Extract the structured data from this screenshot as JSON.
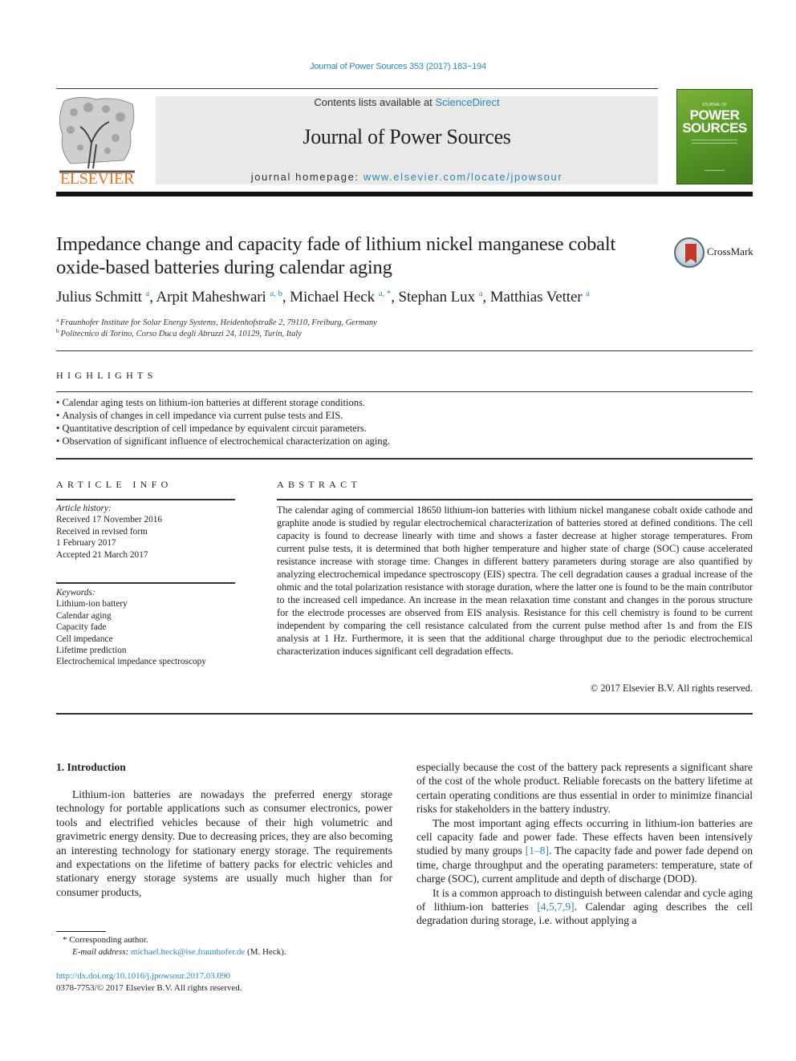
{
  "journal_reference": "Journal of Power Sources 353 (2017) 183−194",
  "header": {
    "publisher": "ELSEVIER",
    "contents_prefix": "Contents lists available at ",
    "contents_link": "ScienceDirect",
    "journal_title": "Journal of Power Sources",
    "homepage_prefix": "journal homepage: ",
    "homepage_link": "www.elsevier.com/locate/jpowsour",
    "cover": {
      "top": "JOURNAL OF",
      "line1": "POWER",
      "line2": "SOURCES"
    },
    "cover_color": "#5a9a28"
  },
  "article": {
    "title": "Impedance change and capacity fade of lithium nickel manganese cobalt oxide-based batteries during calendar aging",
    "crossmark": "CrossMark",
    "authors": [
      {
        "name": "Julius Schmitt",
        "sup": "a"
      },
      {
        "name": "Arpit Maheshwari",
        "sup": "a, b"
      },
      {
        "name": "Michael Heck",
        "sup": "a, *"
      },
      {
        "name": "Stephan Lux",
        "sup": "a"
      },
      {
        "name": "Matthias Vetter",
        "sup": "a"
      }
    ],
    "affiliations": [
      {
        "mark": "a",
        "text": "Fraunhofer Institute for Solar Energy Systems, Heidenhofstraße 2, 79110, Freiburg, Germany"
      },
      {
        "mark": "b",
        "text": "Politecnico di Torino, Corso Duca degli Abruzzi 24, 10129, Turin, Italy"
      }
    ]
  },
  "highlights": {
    "heading": "HIGHLIGHTS",
    "items": [
      "Calendar aging tests on lithium-ion batteries at different storage conditions.",
      "Analysis of changes in cell impedance via current pulse tests and EIS.",
      "Quantitative description of cell impedance by equivalent circuit parameters.",
      "Observation of significant influence of electrochemical characterization on aging."
    ]
  },
  "article_info": {
    "heading": "ARTICLE INFO",
    "history_label": "Article history:",
    "history": [
      "Received 17 November 2016",
      "Received in revised form",
      "1 February 2017",
      "Accepted 21 March 2017"
    ],
    "keywords_label": "Keywords:",
    "keywords": [
      "Lithium-ion battery",
      "Calendar aging",
      "Capacity fade",
      "Cell impedance",
      "Lifetime prediction",
      "Electrochemical impedance spectroscopy"
    ]
  },
  "abstract": {
    "heading": "ABSTRACT",
    "text": "The calendar aging of commercial 18650 lithium-ion batteries with lithium nickel manganese cobalt oxide cathode and graphite anode is studied by regular electrochemical characterization of batteries stored at defined conditions. The cell capacity is found to decrease linearly with time and shows a faster decrease at higher storage temperatures. From current pulse tests, it is determined that both higher temperature and higher state of charge (SOC) cause accelerated resistance increase with storage time. Changes in different battery parameters during storage are also quantified by analyzing electrochemical impedance spectroscopy (EIS) spectra. The cell degradation causes a gradual increase of the ohmic and the total polarization resistance with storage duration, where the latter one is found to be the main contributor to the increased cell impedance. An increase in the mean relaxation time constant and changes in the porous structure for the electrode processes are observed from EIS analysis. Resistance for this cell chemistry is found to be current independent by comparing the cell resistance calculated from the current pulse method after 1s and from the EIS analysis at 1 Hz. Furthermore, it is seen that the additional charge throughput due to the periodic electrochemical characterization induces significant cell degradation effects.",
    "copyright": "© 2017 Elsevier B.V. All rights reserved."
  },
  "introduction": {
    "heading": "1.  Introduction",
    "left_para": "Lithium-ion batteries are nowadays the preferred energy storage technology for portable applications such as consumer electronics, power tools and electrified vehicles because of their high volumetric and gravimetric energy density. Due to decreasing prices, they are also becoming an interesting technology for stationary energy storage. The requirements and expectations on the lifetime of battery packs for electric vehicles and stationary energy storage systems are usually much higher than for consumer products,",
    "right_p1": "especially because the cost of the battery pack represents a significant share of the cost of the whole product. Reliable forecasts on the battery lifetime at certain operating conditions are thus essential in order to minimize financial risks for stakeholders in the battery industry.",
    "right_p2_a": "The most important aging effects occurring in lithium-ion batteries are cell capacity fade and power fade. These effects haven been intensively studied by many groups ",
    "right_p2_ref": "[1–8]",
    "right_p2_b": ". The capacity fade and power fade depend on time, charge throughput and the operating parameters: temperature, state of charge (SOC), current amplitude and depth of discharge (DOD).",
    "right_p3_a": "It is a common approach to distinguish between calendar and cycle aging of lithium-ion batteries ",
    "right_p3_ref": "[4,5,7,9]",
    "right_p3_b": ". Calendar aging describes the cell degradation during storage, i.e. without applying a"
  },
  "footnotes": {
    "corresponding": "* Corresponding author.",
    "email_label": "E-mail address: ",
    "email": "michael.heck@ise.fraunhofer.de",
    "email_suffix": " (M. Heck).",
    "doi": "http://dx.doi.org/10.1016/j.jpowsour.2017.03.090",
    "issn": "0378-7753/© 2017 Elsevier B.V. All rights reserved."
  }
}
